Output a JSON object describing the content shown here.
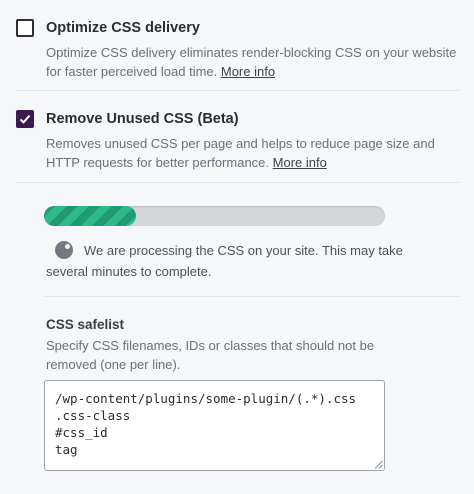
{
  "options": [
    {
      "title": "Optimize CSS delivery",
      "checked": false,
      "description": "Optimize CSS delivery eliminates render-blocking CSS on your website for faster perceived load time.",
      "link": "More info"
    },
    {
      "title": "Remove Unused CSS (Beta)",
      "checked": true,
      "description": "Removes unused CSS per page and helps to reduce page size and HTTP requests for better performance.",
      "link": "More info"
    }
  ],
  "progress": {
    "fraction": 0.27,
    "message": "We are processing the CSS on your site. This may take several minutes to complete."
  },
  "safelist": {
    "title": "CSS safelist",
    "description": "Specify CSS filenames, IDs or classes that should not be removed (one per line).",
    "value": "/wp-content/plugins/some-plugin/(.*).css\n.css-class\n#css_id\ntag"
  },
  "colors": {
    "checkbox_checked": "#3c1a4e",
    "progress_fill": "#2db98a",
    "progress_track": "#d4d6d9"
  }
}
